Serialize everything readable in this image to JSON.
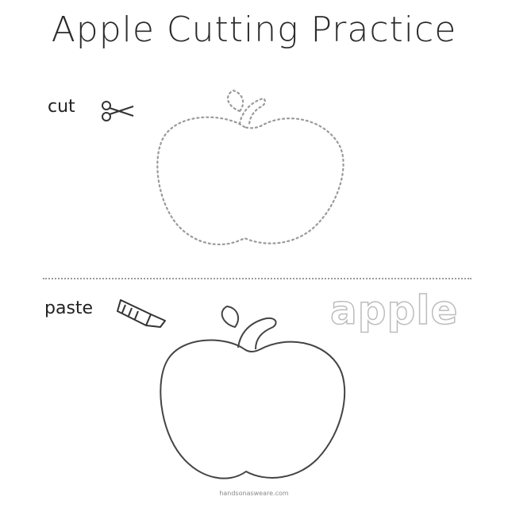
{
  "worksheet": {
    "title": "Apple Cutting Practice",
    "cut_label": "cut",
    "paste_label": "paste",
    "word": "apple",
    "footer": "handsonasweare.com"
  },
  "icons": {
    "cut": "scissors-icon",
    "paste": "glue-stick-icon",
    "outline_shape": "apple-icon"
  },
  "colors": {
    "ink": "#2a2a2a",
    "dotted_line": "#9a9a9a",
    "word_outline": "#bdbdbd"
  }
}
